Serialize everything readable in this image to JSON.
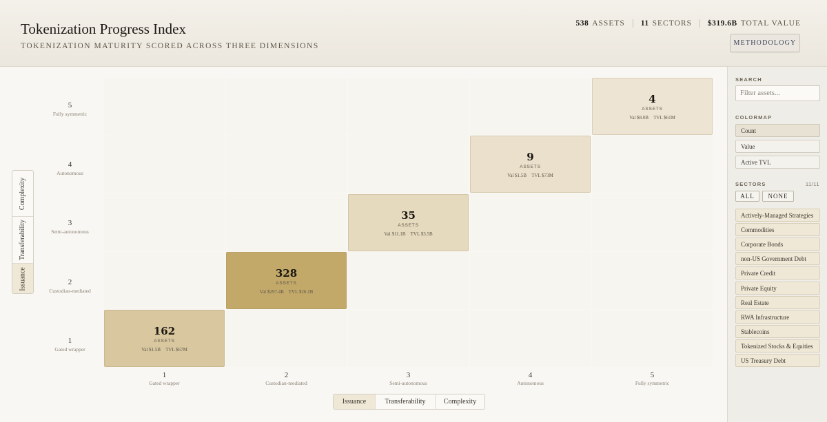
{
  "header": {
    "title": "Tokenization Progress Index",
    "subtitle": "TOKENIZATION MATURITY SCORED ACROSS THREE DIMENSIONS",
    "stats": [
      {
        "value": "538",
        "label": "ASSETS"
      },
      {
        "value": "11",
        "label": "SECTORS"
      },
      {
        "value": "$319.6B",
        "label": "TOTAL VALUE"
      }
    ],
    "methodology_label": "METHODOLOGY"
  },
  "sidebar": {
    "search_label": "SEARCH",
    "search_placeholder": "Filter assets...",
    "colormap_label": "COLORMAP",
    "colormap_options": [
      "Count",
      "Value",
      "Active TVL"
    ],
    "colormap_selected": "Count",
    "sectors_label": "SECTORS",
    "sectors_count": "11/11",
    "all_label": "ALL",
    "none_label": "NONE",
    "sectors": [
      "Actively-Managed Strategies",
      "Commodities",
      "Corporate Bonds",
      "non-US Government Debt",
      "Private Credit",
      "Private Equity",
      "Real Estate",
      "RWA Infrastructure",
      "Stablecoins",
      "Tokenized Stocks & Equities",
      "US Treasury Debt"
    ]
  },
  "grid": {
    "y_axis": {
      "dimension": "Issuance",
      "levels": [
        {
          "num": "5",
          "label": "Fully symmetric"
        },
        {
          "num": "4",
          "label": "Autonomous"
        },
        {
          "num": "3",
          "label": "Semi-autonomous"
        },
        {
          "num": "2",
          "label": "Custodian-mediated"
        },
        {
          "num": "1",
          "label": "Gated wrapper"
        }
      ]
    },
    "x_axis": {
      "dimension": "Issuance",
      "levels": [
        {
          "num": "1",
          "label": "Gated wrapper"
        },
        {
          "num": "2",
          "label": "Custodian-mediated"
        },
        {
          "num": "3",
          "label": "Semi-autonomous"
        },
        {
          "num": "4",
          "label": "Autonomous"
        },
        {
          "num": "5",
          "label": "Fully symmetric"
        }
      ]
    },
    "cells": [
      {
        "x": 1,
        "y": 1,
        "count": "162",
        "assets_label": "ASSETS",
        "val": "Val $1.5B",
        "tvl": "TVL $67M",
        "intensity": 0.55
      },
      {
        "x": 2,
        "y": 2,
        "count": "328",
        "assets_label": "ASSETS",
        "val": "Val $297.4B",
        "tvl": "TVL $26.1B",
        "intensity": 1.0
      },
      {
        "x": 3,
        "y": 3,
        "count": "35",
        "assets_label": "ASSETS",
        "val": "Val $11.1B",
        "tvl": "TVL $3.5B",
        "intensity": 0.28
      },
      {
        "x": 4,
        "y": 4,
        "count": "9",
        "assets_label": "ASSETS",
        "val": "Val $1.5B",
        "tvl": "TVL $73M",
        "intensity": 0.16
      },
      {
        "x": 5,
        "y": 5,
        "count": "4",
        "assets_label": "ASSETS",
        "val": "Val $8.0B",
        "tvl": "TVL $61M",
        "intensity": 0.1
      }
    ]
  },
  "axis_toggle": {
    "vertical": [
      "Issuance",
      "Transferability",
      "Complexity"
    ],
    "vertical_active": "Issuance",
    "horizontal": [
      "Issuance",
      "Transferability",
      "Complexity"
    ],
    "horizontal_active": "Issuance"
  },
  "colors": {
    "cell_high": "#c2a96a",
    "cell_low": "#f2ebdf"
  }
}
